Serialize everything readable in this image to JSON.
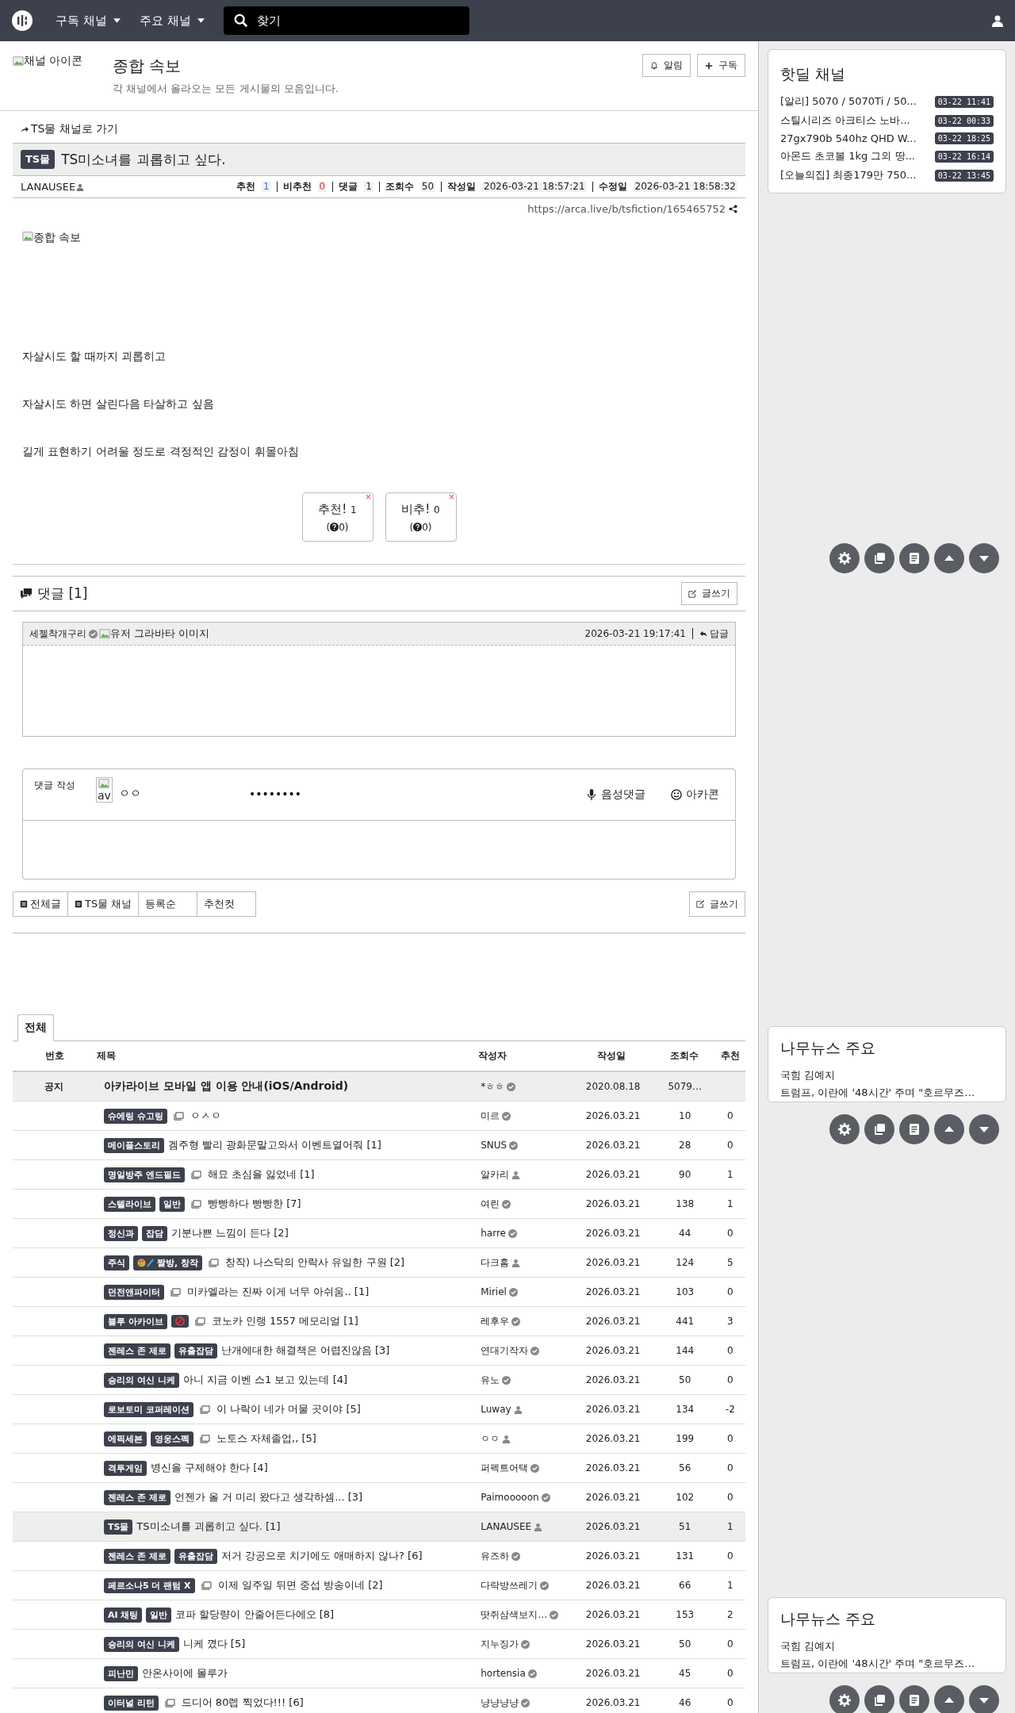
{
  "header": {
    "nav": [
      "구독 채널",
      "주요 채널"
    ],
    "search": {
      "placeholder": "찾기"
    }
  },
  "channel": {
    "icon_alt": "채널 아이콘",
    "title": "종합 속보",
    "description": "각 채널에서 올라오는 모든 게시물의 모음입니다.",
    "buttons": [
      {
        "label": "알림",
        "kind": "bell"
      },
      {
        "label": "구독",
        "kind": "plus"
      }
    ]
  },
  "article": {
    "back_link": "TS물 채널로 가기",
    "badge": "TS물",
    "title": "TS미소녀를 괴롭히고 싶다.",
    "author": "LANAUSEE",
    "stats": [
      {
        "label": "추천",
        "value": "1",
        "kind": "up"
      },
      {
        "label": "비추천",
        "value": "0",
        "kind": "down"
      },
      {
        "label": "댓글",
        "value": "1",
        "kind": "plain"
      },
      {
        "label": "조회수",
        "value": "50",
        "kind": "plain"
      },
      {
        "label": "작성일",
        "value": "2026-03-21 18:57:21",
        "kind": "date"
      },
      {
        "label": "수정일",
        "value": "2026-03-21 18:58:32",
        "kind": "date"
      }
    ],
    "url": "https://arca.live/b/tsfiction/165465752",
    "image_alt": "종합 속보",
    "paragraphs": [
      "자살시도 할 때까지 괴롭히고",
      "자살시도 하면 살린다음 타살하고 싶음",
      "길게 표현하기 어려울 정도로 격정적인 감정이 휘몰아침"
    ],
    "votes": [
      {
        "label": "추천!",
        "count": "1",
        "sub_before": "(",
        "sub_after": "0)"
      },
      {
        "label": "비추!",
        "count": "0",
        "sub_before": "(",
        "sub_after": "0)"
      }
    ]
  },
  "comments": {
    "title": "댓글 [1]",
    "write": "글쓰기",
    "items": [
      {
        "author": "세젤착개구리",
        "avatar_alt": "유저 그라바타 이미지",
        "time": "2026-03-21 19:17:41",
        "reply": "답글"
      }
    ]
  },
  "comment_form": {
    "label": "댓글 작성",
    "avatar_alt": "av",
    "nickname": "ㅇㅇ",
    "password": "••••••••",
    "voice": "음성댓글",
    "arcacon": "아카콘"
  },
  "board_tabs": [
    {
      "label": "전체글",
      "icon": true
    },
    {
      "label": "TS물 채널",
      "icon": true
    },
    {
      "label": "등록순",
      "icon": false
    },
    {
      "label": "추천컷",
      "icon": false
    }
  ],
  "board_write": "글쓰기",
  "list_tabs": [
    {
      "label": "전체",
      "selected": true
    }
  ],
  "table": {
    "columns": [
      "번호",
      "제목",
      "작성자",
      "작성일",
      "조회수",
      "추천"
    ],
    "rows": [
      {
        "kind": "notice",
        "number": "공지",
        "badges": [],
        "image": false,
        "title": "아카라이브 모바일 앱 이용 안내(iOS/Android)",
        "author": "*ㅎㅎ",
        "verified": true,
        "date": "2020.08.18",
        "views": "5079…",
        "current": false
      },
      {
        "kind": "post",
        "badges": [
          {
            "text": "슈에링 슈고링"
          }
        ],
        "image": true,
        "title": "ㅇㅅㅇ",
        "author": "미르",
        "verified": true,
        "date": "2026.03.21",
        "views": "10",
        "votes": "0",
        "current": false
      },
      {
        "kind": "post",
        "badges": [
          {
            "text": "메이플스토리"
          }
        ],
        "image": false,
        "title": "겜주형 빨리 광화문말고와서 이벤트열어줘 [1]",
        "author": "SNUS",
        "verified": true,
        "date": "2026.03.21",
        "views": "28",
        "votes": "0",
        "current": false
      },
      {
        "kind": "post",
        "badges": [
          {
            "text": "명일방주 엔드필드"
          }
        ],
        "image": true,
        "title": "해묘 초심을 잃었네 [1]",
        "author": "알카리",
        "verified": false,
        "date": "2026.03.21",
        "views": "90",
        "votes": "1",
        "current": false
      },
      {
        "kind": "post",
        "badges": [
          {
            "text": "스텔라이브"
          },
          {
            "text": "일반"
          }
        ],
        "image": true,
        "title": "빵빵하다 빵빵한 [7]",
        "author": "여린",
        "verified": true,
        "date": "2026.03.21",
        "views": "138",
        "votes": "1",
        "current": false
      },
      {
        "kind": "post",
        "badges": [
          {
            "text": "정신과"
          },
          {
            "text": "잡담"
          }
        ],
        "image": false,
        "title": "기분나쁜 느낌이 든다 [2]",
        "author": "harre",
        "verified": true,
        "date": "2026.03.21",
        "views": "44",
        "votes": "0",
        "current": false
      },
      {
        "kind": "post",
        "badges": [
          {
            "text": "주식"
          },
          {
            "text": "짤방, 창작",
            "kind": "art"
          }
        ],
        "image": true,
        "title": "창작) 나스닥의 안락사 유일한 구원 [2]",
        "author": "다크홈",
        "verified": false,
        "date": "2026.03.21",
        "views": "124",
        "votes": "5",
        "current": false
      },
      {
        "kind": "post",
        "badges": [
          {
            "text": "던전앤파이터"
          }
        ],
        "image": true,
        "title": "미카엘라는 진짜 이게 너무 아쉬움.. [1]",
        "author": "Miriel",
        "verified": true,
        "date": "2026.03.21",
        "views": "103",
        "votes": "0",
        "current": false
      },
      {
        "kind": "post",
        "badges": [
          {
            "text": "블루 아카이브"
          },
          {
            "kind": "adult"
          }
        ],
        "image": true,
        "title": "코노카 인랭 1557 메모리얼 [1]",
        "author": "레후우",
        "verified": true,
        "date": "2026.03.21",
        "views": "441",
        "votes": "3",
        "current": false
      },
      {
        "kind": "post",
        "badges": [
          {
            "text": "젠레스 존 제로"
          },
          {
            "text": "유출잡담"
          }
        ],
        "image": false,
        "title": "난개에대한 해결책은 어렵진않음 [3]",
        "author": "연대기작자",
        "verified": true,
        "date": "2026.03.21",
        "views": "144",
        "votes": "0",
        "current": false
      },
      {
        "kind": "post",
        "badges": [
          {
            "text": "승리의 여신 니케"
          }
        ],
        "image": false,
        "title": "아니 지금 이벤 스1 보고 있는데 [4]",
        "author": "유노",
        "verified": true,
        "date": "2026.03.21",
        "views": "50",
        "votes": "0",
        "current": false
      },
      {
        "kind": "post",
        "badges": [
          {
            "text": "로보토미 코퍼레이션"
          }
        ],
        "image": true,
        "title": "이 나락이 네가 머물 곳이야 [5]",
        "author": "Luway",
        "verified": false,
        "date": "2026.03.21",
        "views": "134",
        "votes": "-2",
        "current": false
      },
      {
        "kind": "post",
        "badges": [
          {
            "text": "에픽세븐"
          },
          {
            "text": "영웅스펙"
          }
        ],
        "image": true,
        "title": "노토스 자체졸업,, [5]",
        "author": "ㅇㅇ",
        "verified": false,
        "date": "2026.03.21",
        "views": "199",
        "votes": "0",
        "current": false
      },
      {
        "kind": "post",
        "badges": [
          {
            "text": "격투게임"
          }
        ],
        "image": false,
        "title": "병신을 구제해야 한다 [4]",
        "author": "퍼펙트어택",
        "verified": true,
        "date": "2026.03.21",
        "views": "56",
        "votes": "0",
        "current": false
      },
      {
        "kind": "post",
        "badges": [
          {
            "text": "젠레스 존 제로"
          }
        ],
        "image": false,
        "title": "언젠가 올 거 미리 왔다고 생각하셈... [3]",
        "author": "Paimooooon",
        "verified": true,
        "date": "2026.03.21",
        "views": "102",
        "votes": "0",
        "current": false
      },
      {
        "kind": "post",
        "badges": [
          {
            "text": "TS물"
          }
        ],
        "image": false,
        "title": "TS미소녀를 괴롭히고 싶다. [1]",
        "author": "LANAUSEE",
        "verified": false,
        "date": "2026.03.21",
        "views": "51",
        "votes": "1",
        "current": true
      },
      {
        "kind": "post",
        "badges": [
          {
            "text": "젠레스 존 제로"
          },
          {
            "text": "유출잡담"
          }
        ],
        "image": false,
        "title": "저거 강공으로 치기에도 애매하지 않나? [6]",
        "author": "유즈하",
        "verified": true,
        "date": "2026.03.21",
        "views": "131",
        "votes": "0",
        "current": false
      },
      {
        "kind": "post",
        "badges": [
          {
            "text": "페르소나5 더 팬텀 X"
          }
        ],
        "image": true,
        "title": "이제 일주일 뒤면 중섭 방송이네 [2]",
        "author": "다락방쓰레기",
        "verified": true,
        "date": "2026.03.21",
        "views": "66",
        "votes": "1",
        "current": false
      },
      {
        "kind": "post",
        "badges": [
          {
            "text": "AI 채팅"
          },
          {
            "text": "일반"
          }
        ],
        "image": false,
        "title": "코파 할당량이 안줄어든다에오 [8]",
        "author": "땃쥐삼색보지…",
        "verified": true,
        "date": "2026.03.21",
        "views": "153",
        "votes": "2",
        "current": false
      },
      {
        "kind": "post",
        "badges": [
          {
            "text": "승리의 여신 니케"
          }
        ],
        "image": false,
        "title": "니케 꼈다 [5]",
        "author": "지누징가",
        "verified": true,
        "date": "2026.03.21",
        "views": "50",
        "votes": "0",
        "current": false
      },
      {
        "kind": "post",
        "badges": [
          {
            "text": "피난민"
          }
        ],
        "image": false,
        "title": "안온사이에 몰루가",
        "author": "hortensia",
        "verified": true,
        "date": "2026.03.21",
        "views": "45",
        "votes": "0",
        "current": false
      },
      {
        "kind": "post",
        "badges": [
          {
            "text": "이터널 리턴"
          }
        ],
        "image": true,
        "title": "드디어 80렙 찍었다!!! [6]",
        "author": "냥냥냥냥",
        "verified": true,
        "date": "2026.03.21",
        "views": "46",
        "votes": "0",
        "current": false
      }
    ]
  },
  "sidebar": {
    "hotdeal": {
      "title": "핫딜 채널",
      "items": [
        {
          "title": "[알리] 5070 / 5070Ti / 50...",
          "time": "03-22 11:41"
        },
        {
          "title": "스틸시리즈 아크티스 노바...",
          "time": "03-22 00:33"
        },
        {
          "title": "27gx790b 540hz QHD W...",
          "time": "03-22 18:25"
        },
        {
          "title": "아몬드 초코볼 1kg 그외 땅...",
          "time": "03-22 16:14"
        },
        {
          "title": "[오늘의집] 최종179만 750...",
          "time": "03-22 13:45"
        }
      ]
    },
    "news": [
      {
        "title": "나무뉴스 주요",
        "items": [
          "국힘 김예지",
          "트럼프, 이란에 '48시간' 주며 \"호르무즈…"
        ]
      },
      {
        "title": "나무뉴스 주요",
        "items": [
          "국힘 김예지",
          "트럼프, 이란에 '48시간' 주며 \"호르무즈…"
        ]
      }
    ]
  }
}
